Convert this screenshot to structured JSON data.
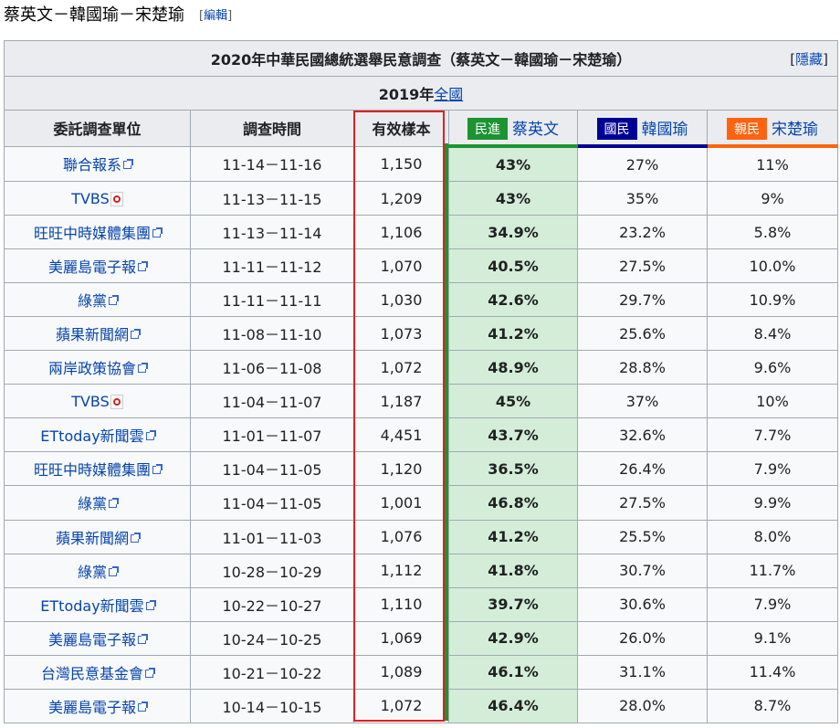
{
  "section": {
    "title": "蔡英文－韓國瑜－宋楚瑜",
    "edit_open": "[",
    "edit_label": "編輯",
    "edit_close": "]"
  },
  "table": {
    "title": "2020年中華民國總統選舉民意調查（蔡英文－韓國瑜－宋楚瑜）",
    "hide_open": "[",
    "hide_label": "隱藏",
    "hide_close": "]",
    "subtitle_prefix": "2019年",
    "subtitle_link": "全國",
    "headers": {
      "pollster": "委託調查單位",
      "date": "調查時間",
      "sample": "有效樣本",
      "dpp_party": "民進",
      "dpp_candidate": "蔡英文",
      "kmt_party": "國民",
      "kmt_candidate": "韓國瑜",
      "pfp_party": "親民",
      "pfp_candidate": "宋楚瑜"
    },
    "rows": [
      {
        "pollster": "聯合報系",
        "source": "external-link",
        "date": "11-14－11-16",
        "sample": "1,150",
        "tsai": "43%",
        "han": "27%",
        "soong": "11%"
      },
      {
        "pollster": "TVBS",
        "source": "pdf",
        "date": "11-13－11-15",
        "sample": "1,209",
        "tsai": "43%",
        "han": "35%",
        "soong": "9%"
      },
      {
        "pollster": "旺旺中時媒體集團",
        "source": "external-link",
        "date": "11-13－11-14",
        "sample": "1,106",
        "tsai": "34.9%",
        "han": "23.2%",
        "soong": "5.8%"
      },
      {
        "pollster": "美麗島電子報",
        "source": "external-link",
        "date": "11-11－11-12",
        "sample": "1,070",
        "tsai": "40.5%",
        "han": "27.5%",
        "soong": "10.0%"
      },
      {
        "pollster": "綠黨",
        "source": "external-link",
        "date": "11-11－11-11",
        "sample": "1,030",
        "tsai": "42.6%",
        "han": "29.7%",
        "soong": "10.9%"
      },
      {
        "pollster": "蘋果新聞網",
        "source": "external-link",
        "date": "11-08－11-10",
        "sample": "1,073",
        "tsai": "41.2%",
        "han": "25.6%",
        "soong": "8.4%"
      },
      {
        "pollster": "兩岸政策協會",
        "source": "external-link",
        "date": "11-06－11-08",
        "sample": "1,072",
        "tsai": "48.9%",
        "han": "28.8%",
        "soong": "9.6%"
      },
      {
        "pollster": "TVBS",
        "source": "pdf",
        "date": "11-04－11-07",
        "sample": "1,187",
        "tsai": "45%",
        "han": "37%",
        "soong": "10%"
      },
      {
        "pollster": "ETtoday新聞雲",
        "source": "external-link",
        "date": "11-01－11-07",
        "sample": "4,451",
        "tsai": "43.7%",
        "han": "32.6%",
        "soong": "7.7%"
      },
      {
        "pollster": "旺旺中時媒體集團",
        "source": "external-link",
        "date": "11-04－11-05",
        "sample": "1,120",
        "tsai": "36.5%",
        "han": "26.4%",
        "soong": "7.9%"
      },
      {
        "pollster": "綠黨",
        "source": "external-link",
        "date": "11-04－11-05",
        "sample": "1,001",
        "tsai": "46.8%",
        "han": "27.5%",
        "soong": "9.9%"
      },
      {
        "pollster": "蘋果新聞網",
        "source": "external-link",
        "date": "11-01－11-03",
        "sample": "1,076",
        "tsai": "41.2%",
        "han": "25.5%",
        "soong": "8.0%"
      },
      {
        "pollster": "綠黨",
        "source": "external-link",
        "date": "10-28－10-29",
        "sample": "1,112",
        "tsai": "41.8%",
        "han": "30.7%",
        "soong": "11.7%"
      },
      {
        "pollster": "ETtoday新聞雲",
        "source": "external-link",
        "date": "10-22－10-27",
        "sample": "1,110",
        "tsai": "39.7%",
        "han": "30.6%",
        "soong": "7.9%"
      },
      {
        "pollster": "美麗島電子報",
        "source": "external-link",
        "date": "10-24－10-25",
        "sample": "1,069",
        "tsai": "42.9%",
        "han": "26.0%",
        "soong": "9.1%"
      },
      {
        "pollster": "台灣民意基金會",
        "source": "external-link",
        "date": "10-21－10-22",
        "sample": "1,089",
        "tsai": "46.1%",
        "han": "31.1%",
        "soong": "11.4%"
      },
      {
        "pollster": "美麗島電子報",
        "source": "external-link",
        "date": "10-14－10-15",
        "sample": "1,072",
        "tsai": "46.4%",
        "han": "28.0%",
        "soong": "8.7%"
      }
    ]
  },
  "colors": {
    "dpp": "#1b9431",
    "kmt": "#000095",
    "pfp": "#ff6310",
    "highlight": "#d4edd9",
    "sample_box": "#e02020"
  }
}
